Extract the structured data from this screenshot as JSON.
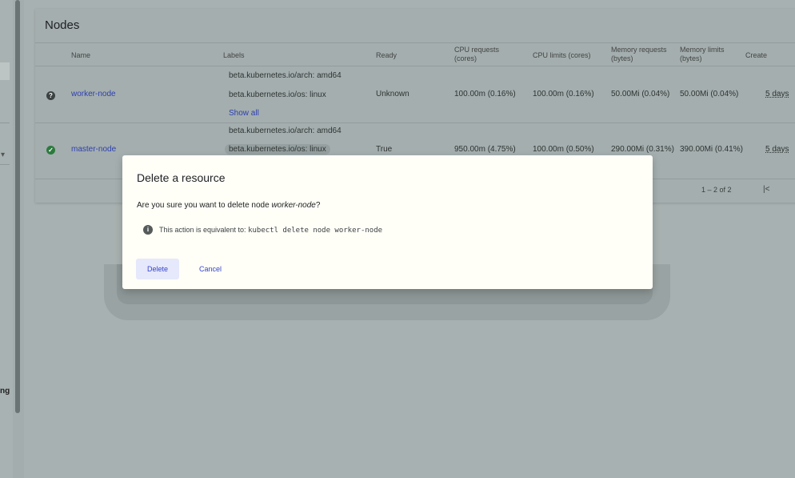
{
  "sidebar": {
    "partial_text": "ng"
  },
  "card": {
    "title": "Nodes",
    "columns": [
      "Name",
      "Labels",
      "Ready",
      "CPU requests (cores)",
      "CPU limits (cores)",
      "Memory requests (bytes)",
      "Memory limits (bytes)",
      "Create"
    ],
    "rows": [
      {
        "status_icon": "question-icon",
        "name": "worker-node",
        "labels": [
          "beta.kubernetes.io/arch: amd64",
          "beta.kubernetes.io/os: linux"
        ],
        "show_all": "Show all",
        "ready": "Unknown",
        "cpu_requests": "100.00m (0.16%)",
        "cpu_limits": "100.00m (0.16%)",
        "memory_requests": "50.00Mi (0.04%)",
        "memory_limits": "50.00Mi (0.04%)",
        "created": "5 days"
      },
      {
        "status_icon": "check-icon",
        "name": "master-node",
        "labels": [
          "beta.kubernetes.io/arch: amd64",
          "beta.kubernetes.io/os: linux"
        ],
        "ready": "True",
        "cpu_requests": "950.00m (4.75%)",
        "cpu_limits": "100.00m (0.50%)",
        "memory_requests": "290.00Mi (0.31%)",
        "memory_limits": "390.00Mi (0.41%)",
        "created": "5 days"
      }
    ],
    "pagination": {
      "range": "1 – 2 of 2",
      "first_page": "|<"
    }
  },
  "dialog": {
    "title": "Delete a resource",
    "question_prefix": "Are you sure you want to delete node ",
    "node_name": "worker-node",
    "question_suffix": "?",
    "info_prefix": "This action is equivalent to: ",
    "info_command": "kubectl delete node worker-node",
    "delete_label": "Delete",
    "cancel_label": "Cancel"
  }
}
